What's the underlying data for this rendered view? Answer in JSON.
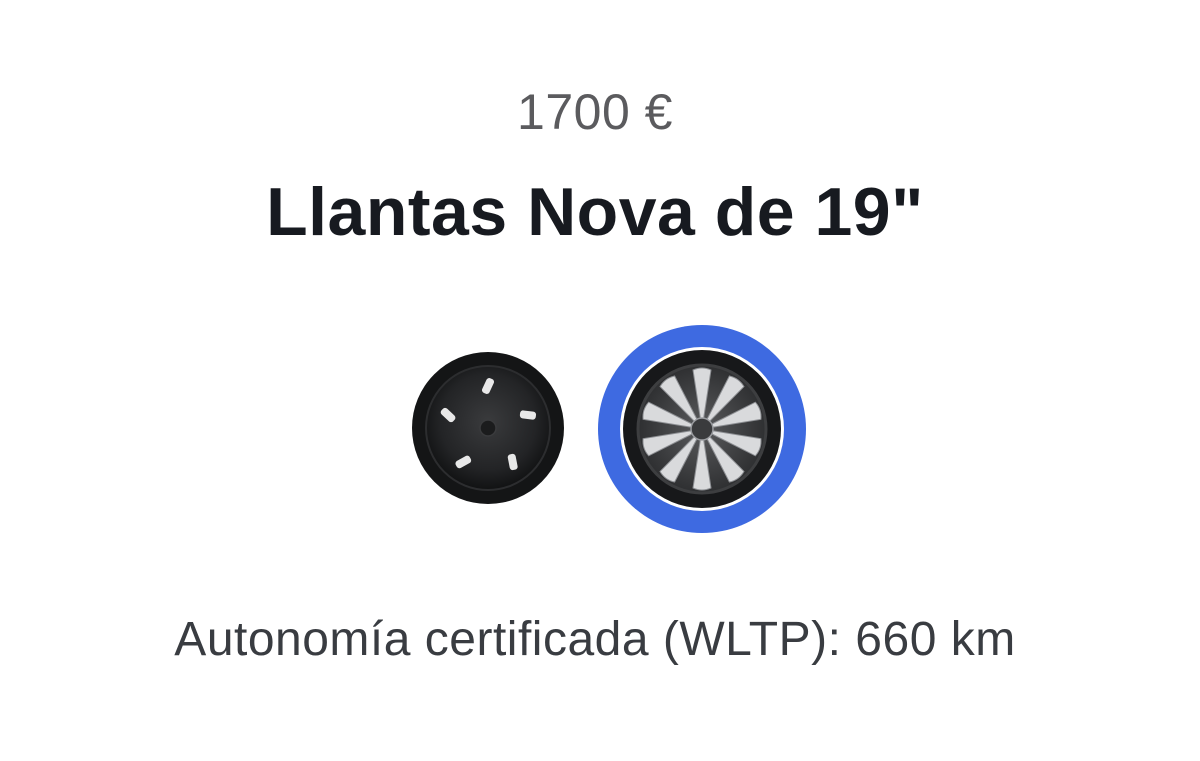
{
  "wheels": {
    "price": "1700 €",
    "title": "Llantas Nova de 19\"",
    "options": [
      {
        "icon": "aero-wheel-icon",
        "selected": false
      },
      {
        "icon": "nova-wheel-icon",
        "selected": true
      }
    ],
    "range_text": "Autonomía certificada (WLTP): 660 km",
    "accent_color": "#3e6ae1"
  }
}
